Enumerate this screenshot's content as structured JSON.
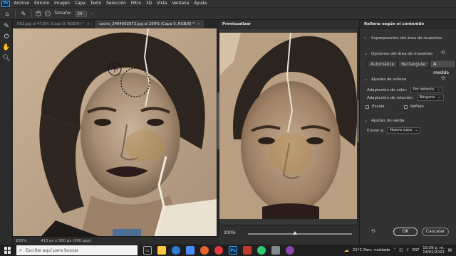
{
  "app": {
    "logo": "Ps",
    "menu": [
      "Archivo",
      "Edición",
      "Imagen",
      "Capa",
      "Texto",
      "Selección",
      "Filtro",
      "3D",
      "Vista",
      "Ventana",
      "Ayuda"
    ]
  },
  "options_bar": {
    "size_label": "Tamaño:",
    "size_value": "20"
  },
  "tools": [
    "brush-tool",
    "lasso-tool",
    "hand-tool",
    "zoom-tool"
  ],
  "tabs": [
    {
      "label": "002.jpg al 47,8% (Capa 0, RGB/8) *",
      "active": false
    },
    {
      "label": "cache_2464002873.jpg al 200% (Capa 0, RGB/8) *",
      "active": true
    }
  ],
  "status": {
    "zoom": "200%",
    "doc_size": "413 px x 500 px (300 ppp)"
  },
  "preview": {
    "title": "Previsualizar",
    "zoom": "200%",
    "zoom_slider_level": 0.45
  },
  "panel": {
    "title": "Relleno según el contenido",
    "overlay_label": "Superposición del área de muestreo",
    "sampling_section": "Opciones del área de muestreo",
    "sampling_modes": [
      "Automático",
      "Rectangular",
      "A medida"
    ],
    "sampling_selected": 2,
    "fill_section": "Ajustes de relleno",
    "color_adapt_label": "Adaptación de color:",
    "color_adapt_value": "Por defecto",
    "rotation_adapt_label": "Adaptación de rotación:",
    "rotation_adapt_value": "Ninguna",
    "scale_label": "Escala",
    "mirror_label": "Reflejo",
    "output_section": "Ajustes de salida",
    "output_label": "Enviar a:",
    "output_value": "Nueva capa",
    "ok": "OK",
    "cancel": "Cancelar"
  },
  "taskbar": {
    "search_placeholder": "Escribe aquí para buscar",
    "weather": "21°C  Parc. nublado",
    "time": "10:39 p. m.",
    "date": "14/02/2022"
  },
  "colors": {
    "accent": "#31a8ff",
    "panel_bg": "#323232",
    "canvas_bg": "#2a2a2a",
    "taskbar_bg": "#202020"
  }
}
